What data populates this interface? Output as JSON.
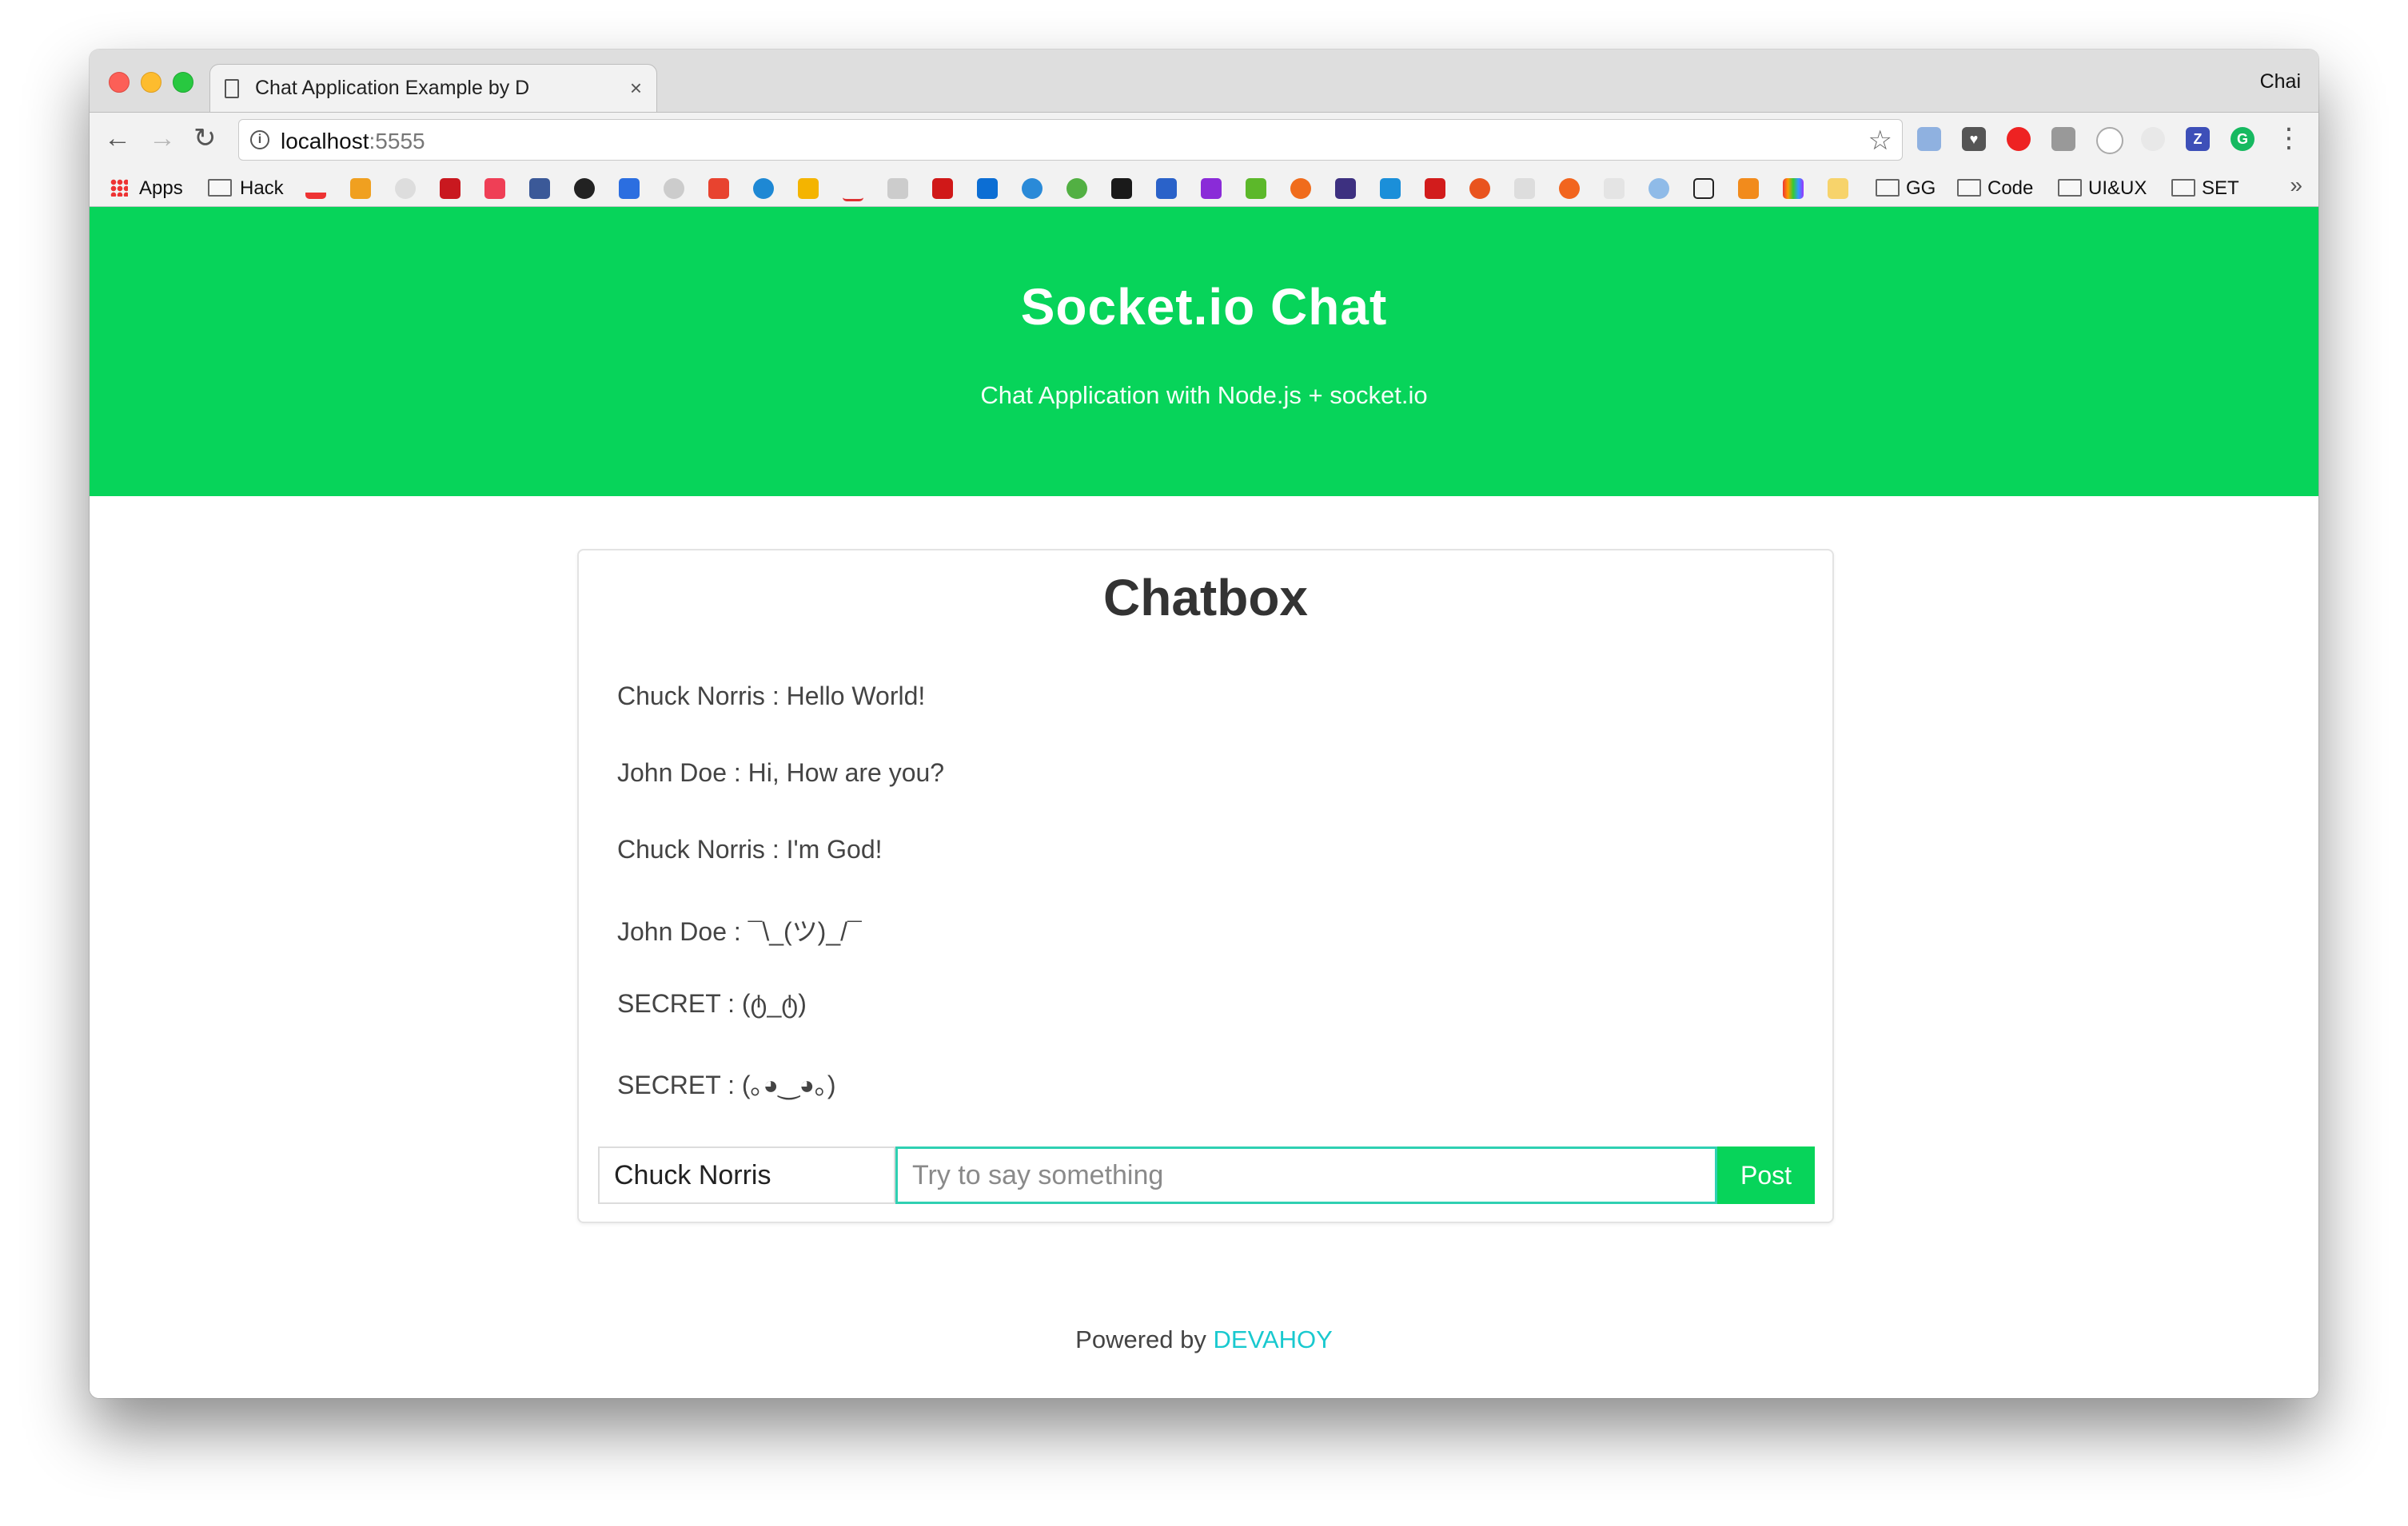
{
  "browser": {
    "tab_title": "Chat Application Example by D",
    "profile_name": "Chai",
    "url_host": "localhost",
    "url_port": ":5555",
    "bookmarks": {
      "apps": "Apps",
      "hack": "Hack",
      "folders": [
        "GG",
        "Code",
        "UI&UX",
        "SET"
      ],
      "more": "»"
    }
  },
  "hero": {
    "title": "Socket.io Chat",
    "subtitle": "Chat Application with Node.js + socket.io"
  },
  "chatbox": {
    "title": "Chatbox",
    "messages": [
      "Chuck Norris : Hello World!",
      "John Doe : Hi, How are you?",
      "Chuck Norris : I'm God!",
      "John Doe : ¯\\_(ツ)_/¯",
      "SECRET : (ტ_ტ)",
      "SECRET : (｡◕‿◕｡)"
    ],
    "name_value": "Chuck Norris",
    "message_placeholder": "Try to say something",
    "post_label": "Post"
  },
  "footer": {
    "prefix": "Powered by",
    "link": "DEVAHOY"
  },
  "colors": {
    "accent_green": "#07d45a",
    "focus_teal": "#2fd0b2",
    "link_teal": "#19c9cf"
  }
}
